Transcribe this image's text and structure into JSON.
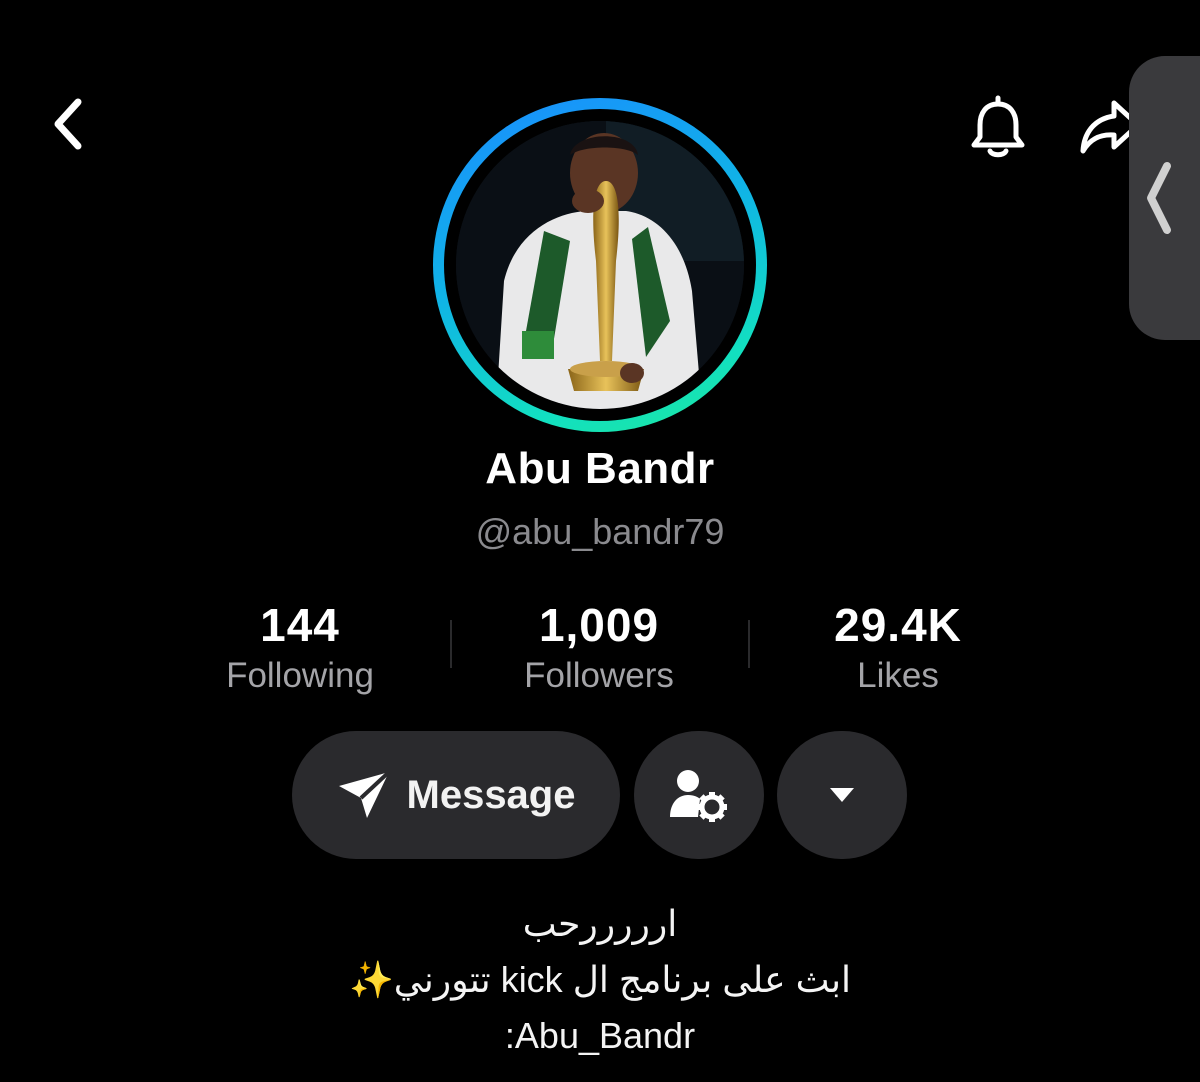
{
  "profile": {
    "display_name": "Abu Bandr",
    "username": "@abu_bandr79"
  },
  "stats": [
    {
      "value": "144",
      "label": "Following"
    },
    {
      "value": "1,009",
      "label": "Followers"
    },
    {
      "value": "29.4K",
      "label": "Likes"
    }
  ],
  "actions": {
    "message_label": "Message"
  },
  "bio": {
    "line1": "ارررررحب",
    "line2": "ابث على برنامج ال kick تتورني",
    "line2_emoji": "✨",
    "line3": ":Abu_Bandr"
  },
  "icons": {
    "back": "chevron-left-icon",
    "bell": "bell-icon",
    "share": "share-arrow-icon",
    "side_handle": "chevron-left-icon",
    "send": "paper-plane-icon",
    "user_settings": "user-gear-icon",
    "dropdown": "caret-down-icon"
  },
  "colors": {
    "background": "#000000",
    "ring_start": "#1a8cff",
    "ring_end": "#1fe89a",
    "button_bg": "#2a2a2d",
    "secondary_text": "#8a8a8e"
  }
}
